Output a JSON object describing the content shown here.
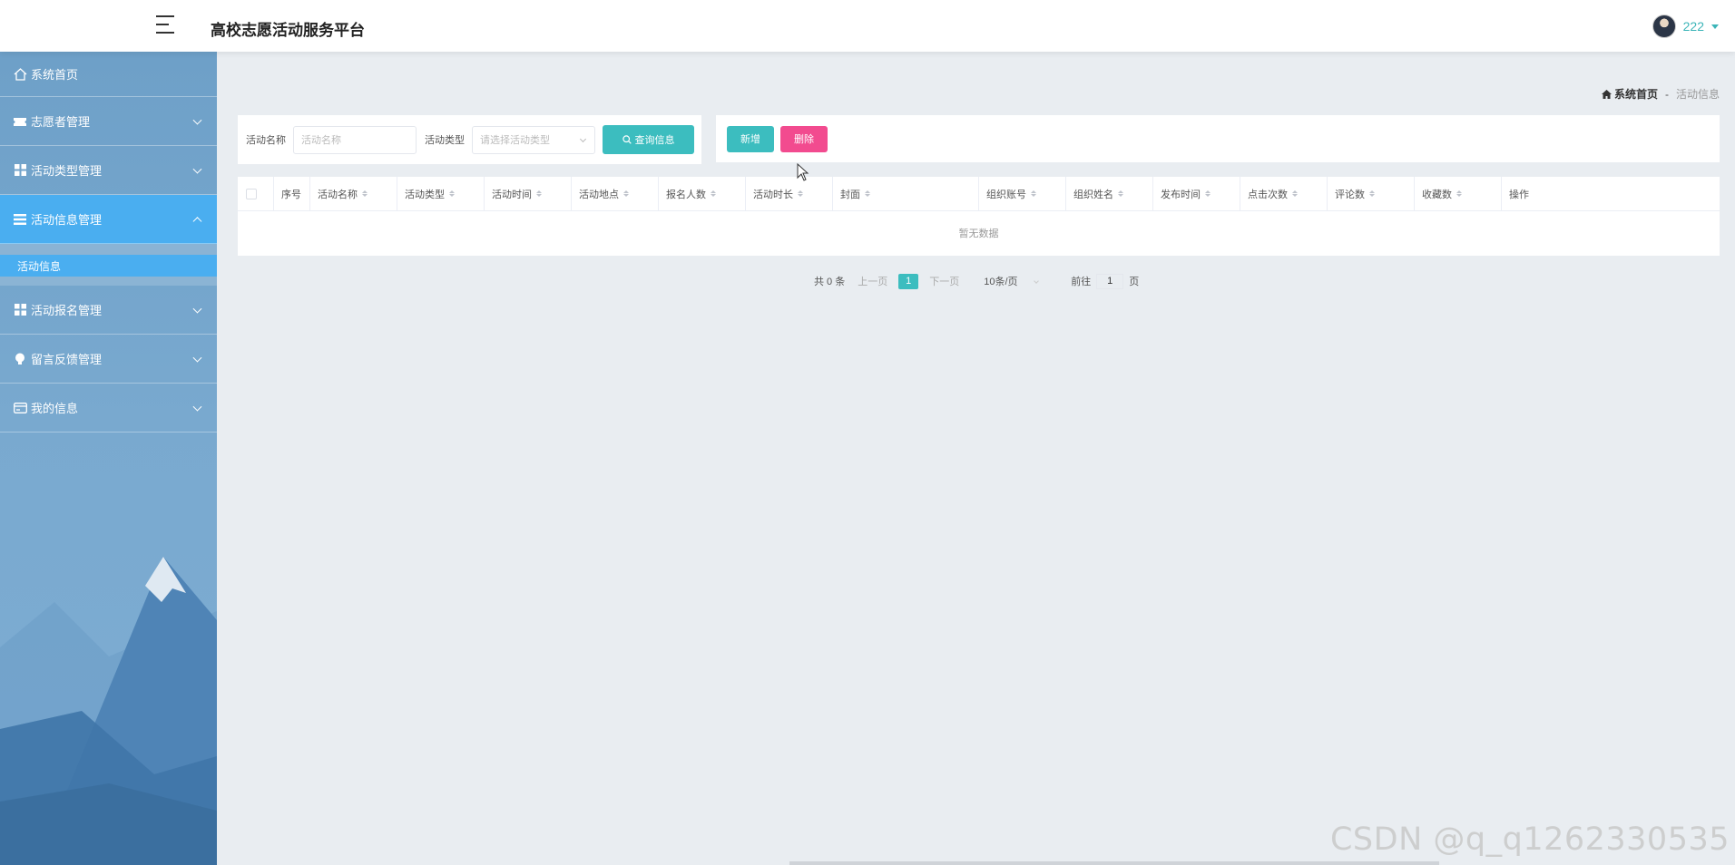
{
  "header": {
    "title": "高校志愿活动服务平台",
    "user_name": "222"
  },
  "sidebar": {
    "items": [
      {
        "label": "系统首页",
        "icon": "home-icon"
      },
      {
        "label": "志愿者管理",
        "icon": "ticket-icon"
      },
      {
        "label": "活动类型管理",
        "icon": "grid-icon"
      },
      {
        "label": "活动信息管理",
        "icon": "list-icon",
        "active": true
      },
      {
        "label": "活动报名管理",
        "icon": "grid-icon"
      },
      {
        "label": "留言反馈管理",
        "icon": "bulb-icon"
      },
      {
        "label": "我的信息",
        "icon": "card-icon"
      }
    ],
    "submenu_item": "活动信息"
  },
  "breadcrumb": {
    "home": "系统首页",
    "separator": "-",
    "current": "活动信息"
  },
  "search": {
    "name_label": "活动名称",
    "name_placeholder": "活动名称",
    "type_label": "活动类型",
    "type_placeholder": "请选择活动类型",
    "button": "查询信息"
  },
  "actions": {
    "add": "新增",
    "delete": "删除"
  },
  "table": {
    "columns": [
      "序号",
      "活动名称",
      "活动类型",
      "活动时间",
      "活动地点",
      "报名人数",
      "活动时长",
      "封面",
      "组织账号",
      "组织姓名",
      "发布时间",
      "点击次数",
      "评论数",
      "收藏数",
      "操作"
    ],
    "empty_text": "暂无数据"
  },
  "pagination": {
    "total": "共 0 条",
    "prev": "上一页",
    "current_page": "1",
    "next": "下一页",
    "page_size": "10条/页",
    "goto_label": "前往",
    "goto_value": "1",
    "goto_suffix": "页"
  },
  "watermark": "CSDN @q_q1262330535",
  "colors": {
    "accent": "#3cbdbf",
    "danger": "#f24b8f",
    "sidebar_active": "#4aaef0"
  }
}
